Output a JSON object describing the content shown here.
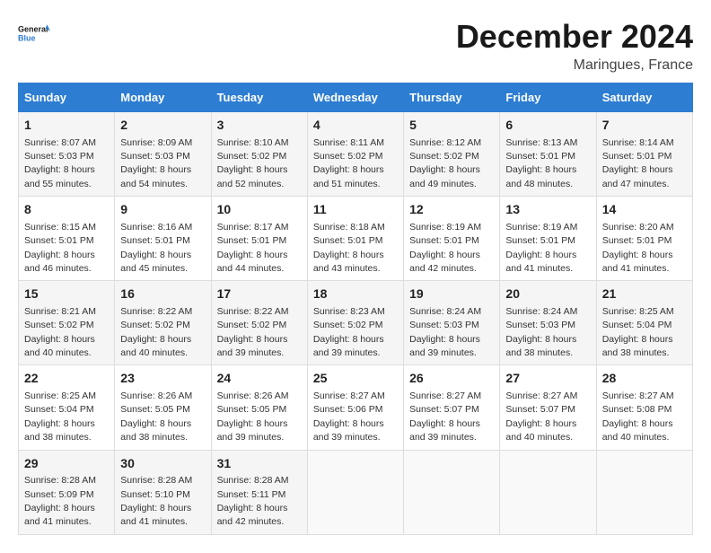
{
  "logo": {
    "line1": "General",
    "line2": "Blue"
  },
  "title": "December 2024",
  "location": "Maringues, France",
  "days_header": [
    "Sunday",
    "Monday",
    "Tuesday",
    "Wednesday",
    "Thursday",
    "Friday",
    "Saturday"
  ],
  "weeks": [
    [
      {
        "day": "1",
        "rise": "Sunrise: 8:07 AM",
        "set": "Sunset: 5:03 PM",
        "daylight": "Daylight: 8 hours and 55 minutes."
      },
      {
        "day": "2",
        "rise": "Sunrise: 8:09 AM",
        "set": "Sunset: 5:03 PM",
        "daylight": "Daylight: 8 hours and 54 minutes."
      },
      {
        "day": "3",
        "rise": "Sunrise: 8:10 AM",
        "set": "Sunset: 5:02 PM",
        "daylight": "Daylight: 8 hours and 52 minutes."
      },
      {
        "day": "4",
        "rise": "Sunrise: 8:11 AM",
        "set": "Sunset: 5:02 PM",
        "daylight": "Daylight: 8 hours and 51 minutes."
      },
      {
        "day": "5",
        "rise": "Sunrise: 8:12 AM",
        "set": "Sunset: 5:02 PM",
        "daylight": "Daylight: 8 hours and 49 minutes."
      },
      {
        "day": "6",
        "rise": "Sunrise: 8:13 AM",
        "set": "Sunset: 5:01 PM",
        "daylight": "Daylight: 8 hours and 48 minutes."
      },
      {
        "day": "7",
        "rise": "Sunrise: 8:14 AM",
        "set": "Sunset: 5:01 PM",
        "daylight": "Daylight: 8 hours and 47 minutes."
      }
    ],
    [
      {
        "day": "8",
        "rise": "Sunrise: 8:15 AM",
        "set": "Sunset: 5:01 PM",
        "daylight": "Daylight: 8 hours and 46 minutes."
      },
      {
        "day": "9",
        "rise": "Sunrise: 8:16 AM",
        "set": "Sunset: 5:01 PM",
        "daylight": "Daylight: 8 hours and 45 minutes."
      },
      {
        "day": "10",
        "rise": "Sunrise: 8:17 AM",
        "set": "Sunset: 5:01 PM",
        "daylight": "Daylight: 8 hours and 44 minutes."
      },
      {
        "day": "11",
        "rise": "Sunrise: 8:18 AM",
        "set": "Sunset: 5:01 PM",
        "daylight": "Daylight: 8 hours and 43 minutes."
      },
      {
        "day": "12",
        "rise": "Sunrise: 8:19 AM",
        "set": "Sunset: 5:01 PM",
        "daylight": "Daylight: 8 hours and 42 minutes."
      },
      {
        "day": "13",
        "rise": "Sunrise: 8:19 AM",
        "set": "Sunset: 5:01 PM",
        "daylight": "Daylight: 8 hours and 41 minutes."
      },
      {
        "day": "14",
        "rise": "Sunrise: 8:20 AM",
        "set": "Sunset: 5:01 PM",
        "daylight": "Daylight: 8 hours and 41 minutes."
      }
    ],
    [
      {
        "day": "15",
        "rise": "Sunrise: 8:21 AM",
        "set": "Sunset: 5:02 PM",
        "daylight": "Daylight: 8 hours and 40 minutes."
      },
      {
        "day": "16",
        "rise": "Sunrise: 8:22 AM",
        "set": "Sunset: 5:02 PM",
        "daylight": "Daylight: 8 hours and 40 minutes."
      },
      {
        "day": "17",
        "rise": "Sunrise: 8:22 AM",
        "set": "Sunset: 5:02 PM",
        "daylight": "Daylight: 8 hours and 39 minutes."
      },
      {
        "day": "18",
        "rise": "Sunrise: 8:23 AM",
        "set": "Sunset: 5:02 PM",
        "daylight": "Daylight: 8 hours and 39 minutes."
      },
      {
        "day": "19",
        "rise": "Sunrise: 8:24 AM",
        "set": "Sunset: 5:03 PM",
        "daylight": "Daylight: 8 hours and 39 minutes."
      },
      {
        "day": "20",
        "rise": "Sunrise: 8:24 AM",
        "set": "Sunset: 5:03 PM",
        "daylight": "Daylight: 8 hours and 38 minutes."
      },
      {
        "day": "21",
        "rise": "Sunrise: 8:25 AM",
        "set": "Sunset: 5:04 PM",
        "daylight": "Daylight: 8 hours and 38 minutes."
      }
    ],
    [
      {
        "day": "22",
        "rise": "Sunrise: 8:25 AM",
        "set": "Sunset: 5:04 PM",
        "daylight": "Daylight: 8 hours and 38 minutes."
      },
      {
        "day": "23",
        "rise": "Sunrise: 8:26 AM",
        "set": "Sunset: 5:05 PM",
        "daylight": "Daylight: 8 hours and 38 minutes."
      },
      {
        "day": "24",
        "rise": "Sunrise: 8:26 AM",
        "set": "Sunset: 5:05 PM",
        "daylight": "Daylight: 8 hours and 39 minutes."
      },
      {
        "day": "25",
        "rise": "Sunrise: 8:27 AM",
        "set": "Sunset: 5:06 PM",
        "daylight": "Daylight: 8 hours and 39 minutes."
      },
      {
        "day": "26",
        "rise": "Sunrise: 8:27 AM",
        "set": "Sunset: 5:07 PM",
        "daylight": "Daylight: 8 hours and 39 minutes."
      },
      {
        "day": "27",
        "rise": "Sunrise: 8:27 AM",
        "set": "Sunset: 5:07 PM",
        "daylight": "Daylight: 8 hours and 40 minutes."
      },
      {
        "day": "28",
        "rise": "Sunrise: 8:27 AM",
        "set": "Sunset: 5:08 PM",
        "daylight": "Daylight: 8 hours and 40 minutes."
      }
    ],
    [
      {
        "day": "29",
        "rise": "Sunrise: 8:28 AM",
        "set": "Sunset: 5:09 PM",
        "daylight": "Daylight: 8 hours and 41 minutes."
      },
      {
        "day": "30",
        "rise": "Sunrise: 8:28 AM",
        "set": "Sunset: 5:10 PM",
        "daylight": "Daylight: 8 hours and 41 minutes."
      },
      {
        "day": "31",
        "rise": "Sunrise: 8:28 AM",
        "set": "Sunset: 5:11 PM",
        "daylight": "Daylight: 8 hours and 42 minutes."
      },
      null,
      null,
      null,
      null
    ]
  ]
}
